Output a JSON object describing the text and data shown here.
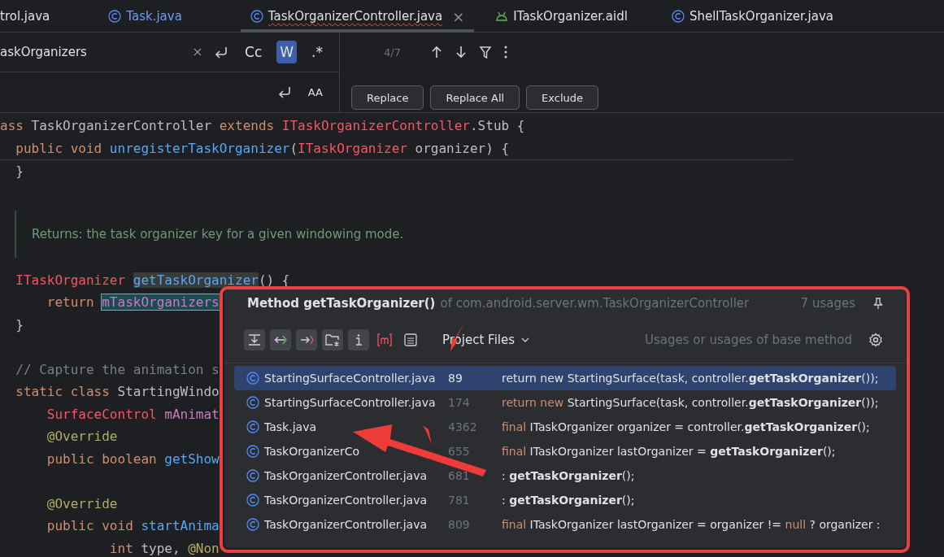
{
  "tabs": [
    {
      "label": "trol.java",
      "kind": "plain",
      "color": "#dfe1e5",
      "selected": false
    },
    {
      "label": "Task.java",
      "kind": "class",
      "color": "#6f9fea",
      "selected": false
    },
    {
      "label": "TaskOrganizerController.java",
      "kind": "class",
      "color": "#dfe1e5",
      "selected": true,
      "close": "×"
    },
    {
      "label": "ITaskOrganizer.aidl",
      "kind": "android",
      "color": "#dfe1e5",
      "selected": false
    },
    {
      "label": "ShellTaskOrganizer.java",
      "kind": "class",
      "color": "#dfe1e5",
      "selected": false
    }
  ],
  "find": {
    "value": "askOrganizers",
    "toggles": [
      {
        "label": "Cc",
        "selected": false
      },
      {
        "label": "W",
        "selected": true
      },
      {
        "label": ".*",
        "selected": false
      }
    ],
    "match_count": "4/7"
  },
  "replace": {
    "toggle_label": "AA",
    "buttons": [
      "Replace",
      "Replace All",
      "Exclude"
    ]
  },
  "code_lines": [
    {
      "kind": "top",
      "tokens": [
        {
          "kind": "kw",
          "text": "ass"
        },
        {
          "kind": "plain",
          "text": " TaskOrganizerController "
        },
        {
          "kind": "kw",
          "text": "extends "
        },
        {
          "kind": "type",
          "text": "ITaskOrganizerController"
        },
        {
          "kind": "plain",
          "text": ".Stub {"
        }
      ]
    },
    {
      "kind": "member",
      "tokens": [
        {
          "kind": "kw",
          "text": "public void "
        },
        {
          "kind": "fn",
          "text": "unregisterTaskOrganizer"
        },
        {
          "kind": "plain",
          "text": "("
        },
        {
          "kind": "type",
          "text": "ITaskOrganizer"
        },
        {
          "kind": "plain",
          "text": " organizer) {"
        }
      ]
    },
    {
      "kind": "member",
      "tokens": [
        {
          "kind": "plain",
          "text": "}"
        }
      ]
    },
    {
      "kind": "doc",
      "text": "Returns: the task organizer key for a given windowing mode."
    },
    {
      "kind": "member",
      "tokens": [
        {
          "kind": "type",
          "text": "ITaskOrganizer "
        },
        {
          "kind": "fn_usage",
          "text": "getTaskOrganizer"
        },
        {
          "kind": "plain",
          "text": "() {"
        }
      ]
    },
    {
      "kind": "body",
      "tokens": [
        {
          "kind": "kw",
          "text": "return "
        },
        {
          "kind": "field_selected",
          "text": "mTaskOrganizers"
        }
      ]
    },
    {
      "kind": "member",
      "tokens": [
        {
          "kind": "plain",
          "text": "}"
        }
      ]
    },
    {
      "kind": "blank"
    },
    {
      "kind": "member",
      "tokens": [
        {
          "kind": "comment",
          "text": "// Capture the animation s"
        }
      ]
    },
    {
      "kind": "member",
      "tokens": [
        {
          "kind": "kw",
          "text": "static class "
        },
        {
          "kind": "plain",
          "text": "StartingWindo"
        }
      ]
    },
    {
      "kind": "body",
      "tokens": [
        {
          "kind": "type",
          "text": "SurfaceControl "
        },
        {
          "kind": "field",
          "text": "mAnimat"
        }
      ]
    },
    {
      "kind": "body",
      "tokens": [
        {
          "kind": "annot",
          "text": "@Override"
        }
      ]
    },
    {
      "kind": "body",
      "tokens": [
        {
          "kind": "kw",
          "text": "public boolean "
        },
        {
          "kind": "fn",
          "text": "getShow"
        }
      ]
    },
    {
      "kind": "blank"
    },
    {
      "kind": "body",
      "tokens": [
        {
          "kind": "annot",
          "text": "@Override"
        }
      ]
    },
    {
      "kind": "body",
      "tokens": [
        {
          "kind": "kw",
          "text": "public void "
        },
        {
          "kind": "fn",
          "text": "startAnima"
        }
      ]
    },
    {
      "kind": "wrap",
      "tokens": [
        {
          "kind": "kw",
          "text": "int "
        },
        {
          "kind": "plain",
          "text": "type, "
        },
        {
          "kind": "annot",
          "text": "@Non"
        }
      ]
    }
  ],
  "usages_popup": {
    "title": "Method getTaskOrganizer()",
    "context": "of com.android.server.wm.TaskOrganizerController",
    "count": "7 usages",
    "tools": [
      {
        "kind": "merge",
        "selected": true
      },
      {
        "kind": "read",
        "selected": true
      },
      {
        "kind": "write",
        "selected": true
      },
      {
        "kind": "folder",
        "selected": true
      },
      {
        "kind": "info",
        "selected": true
      },
      {
        "kind": "method",
        "selected": false
      },
      {
        "kind": "preview",
        "selected": false
      }
    ],
    "scope": "Project Files",
    "filter_hint": "Usages or usages of base method",
    "rows": [
      {
        "file": "StartingSurfaceController.java",
        "line": "89",
        "selected": true,
        "code": [
          {
            "kind": "plain",
            "text": "return new StartingSurface(task, controller."
          },
          {
            "kind": "match",
            "text": "getTaskOrganizer"
          },
          {
            "kind": "plain",
            "text": "());"
          }
        ]
      },
      {
        "file": "StartingSurfaceController.java",
        "line": "174",
        "selected": false,
        "code": [
          {
            "kind": "kw",
            "text": "return new"
          },
          {
            "kind": "plain",
            "text": " StartingSurface(task, controller."
          },
          {
            "kind": "match",
            "text": "getTaskOrganizer"
          },
          {
            "kind": "plain",
            "text": "());"
          }
        ]
      },
      {
        "file": "Task.java",
        "line": "4362",
        "selected": false,
        "code": [
          {
            "kind": "kw",
            "text": "final"
          },
          {
            "kind": "plain",
            "text": " ITaskOrganizer organizer = controller."
          },
          {
            "kind": "match",
            "text": "getTaskOrganizer"
          },
          {
            "kind": "plain",
            "text": "();"
          }
        ]
      },
      {
        "file": "TaskOrganizerCo",
        "line": "655",
        "selected": false,
        "code": [
          {
            "kind": "kw",
            "text": "final"
          },
          {
            "kind": "plain",
            "text": " ITaskOrganizer lastOrganizer = "
          },
          {
            "kind": "match",
            "text": "getTaskOrganizer"
          },
          {
            "kind": "plain",
            "text": "();"
          }
        ]
      },
      {
        "file": "TaskOrganizerController.java",
        "line": "681",
        "selected": false,
        "code": [
          {
            "kind": "plain",
            "text": ": "
          },
          {
            "kind": "match",
            "text": "getTaskOrganizer"
          },
          {
            "kind": "plain",
            "text": "();"
          }
        ]
      },
      {
        "file": "TaskOrganizerController.java",
        "line": "781",
        "selected": false,
        "code": [
          {
            "kind": "plain",
            "text": ": "
          },
          {
            "kind": "match",
            "text": "getTaskOrganizer"
          },
          {
            "kind": "plain",
            "text": "();"
          }
        ]
      },
      {
        "file": "TaskOrganizerController.java",
        "line": "809",
        "selected": false,
        "code": [
          {
            "kind": "kw",
            "text": "final"
          },
          {
            "kind": "plain",
            "text": " ITaskOrganizer lastOrganizer = organizer != "
          },
          {
            "kind": "kw",
            "text": "null"
          },
          {
            "kind": "plain",
            "text": " ? organizer :"
          }
        ]
      }
    ]
  }
}
